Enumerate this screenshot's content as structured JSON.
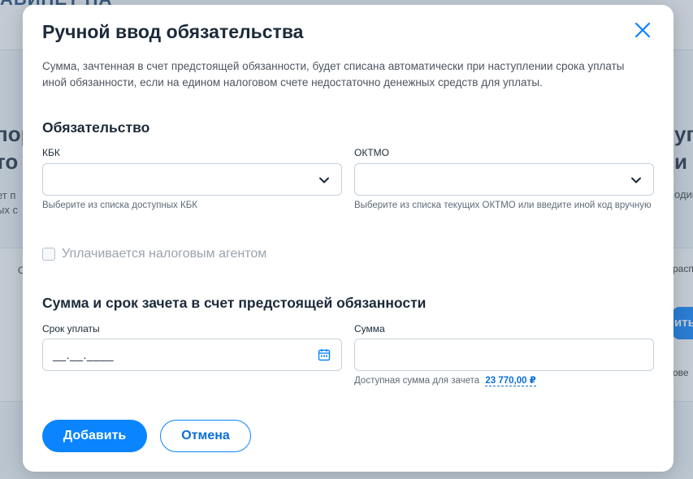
{
  "background": {
    "brand": "АБИНЕТ НА",
    "left_heading": [
      "пор",
      "то н"
    ],
    "right_heading": [
      "уп",
      "и"
    ],
    "left_text": [
      "ет п",
      "ых с"
    ],
    "right_text": "один",
    "left_frag": "С",
    "right_link1": "распр",
    "right_button": "ить",
    "right_link2": "ове"
  },
  "modal": {
    "title": "Ручной ввод обязательства",
    "description": "Сумма, зачтенная в счет предстоящей обязанности, будет списана автоматически при наступлении срока уплаты иной обязанности, если на едином налоговом счете недостаточно денежных средств для уплаты."
  },
  "obligation": {
    "section_title": "Обязательство",
    "kbk": {
      "label": "КБК",
      "value": "",
      "hint": "Выберите из списка доступных КБК"
    },
    "oktmo": {
      "label": "ОКТМО",
      "value": "",
      "hint": "Выберите из списка текущих ОКТМО или введите иной код вручную"
    },
    "agent_checkbox": {
      "label": "Уплачивается налоговым агентом",
      "checked": false
    }
  },
  "amount_section": {
    "section_title": "Сумма и срок зачета в счет предстоящей обязанности",
    "due_date": {
      "label": "Срок уплаты",
      "placeholder": "__.__.____"
    },
    "amount": {
      "label": "Сумма",
      "value": ""
    },
    "available_label": "Доступная сумма для зачета",
    "available_value": "23 770,00 ₽"
  },
  "actions": {
    "add_label": "Добавить",
    "cancel_label": "Отмена"
  },
  "colors": {
    "accent": "#0a84ff",
    "link": "#0a6fd8",
    "title": "#1c2a3a"
  }
}
